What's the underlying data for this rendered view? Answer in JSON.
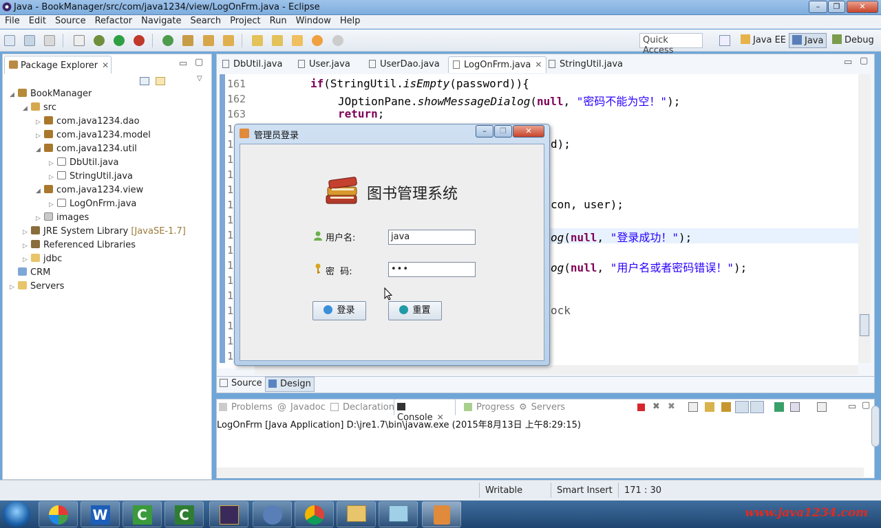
{
  "window": {
    "title": "Java - BookManager/src/com/java1234/view/LogOnFrm.java - Eclipse"
  },
  "menu": [
    "File",
    "Edit",
    "Source",
    "Refactor",
    "Navigate",
    "Search",
    "Project",
    "Run",
    "Window",
    "Help"
  ],
  "toolbar": {
    "quick_access": "Quick Access",
    "perspectives": [
      "Java EE",
      "Java",
      "Debug"
    ]
  },
  "package_explorer": {
    "title": "Package Explorer",
    "items": [
      "BookManager",
      "src",
      "com.java1234.dao",
      "com.java1234.model",
      "com.java1234.util",
      "DbUtil.java",
      "StringUtil.java",
      "com.java1234.view",
      "LogOnFrm.java",
      "images",
      "JRE System Library",
      "[JavaSE-1.7]",
      "Referenced Libraries",
      "jdbc",
      "CRM",
      "Servers"
    ]
  },
  "editor": {
    "tabs": [
      "DbUtil.java",
      "User.java",
      "UserDao.java",
      "LogOnFrm.java",
      "StringUtil.java"
    ],
    "active_tab": "LogOnFrm.java",
    "line_numbers": [
      "161",
      "162",
      "163",
      "1",
      "1",
      "1",
      "1",
      "1",
      "1",
      "1",
      "1",
      "1",
      "1",
      "1",
      "1",
      "1",
      "1",
      "1",
      "1"
    ],
    "code": {
      "l161_kw": "if",
      "l161_a": "(StringUtil.",
      "l161_it": "isEmpty",
      "l161_b": "(password)){",
      "l162_a": "JOptionPane.",
      "l162_it": "showMessageDialog",
      "l162_b": "(",
      "l162_null": "null",
      "l162_c": ", ",
      "l162_str": "\"密码不能为空！\"",
      "l162_d": ");",
      "l163_kw": "return",
      "l163_a": ";",
      "r1": "d);",
      "r2": "con, user);",
      "r3_it": "og",
      "r3_a": "(",
      "r3_null": "null",
      "r3_b": ", ",
      "r3_str": "\"登录成功！\"",
      "r3_c": ");",
      "r4_it": "og",
      "r4_a": "(",
      "r4_null": "null",
      "r4_b": ", ",
      "r4_str": "\"用户名或者密码错误！\"",
      "r4_c": ");",
      "r5": "ock"
    },
    "bottom_tabs": [
      "Source",
      "Design"
    ]
  },
  "dialog": {
    "title": "管理员登录",
    "heading": "图书管理系统",
    "username_label": "用户名:",
    "username_value": "java",
    "password_label": "密  码:",
    "password_value": "•••",
    "login_button": "登录",
    "reset_button": "重置"
  },
  "console": {
    "tabs": [
      "Problems",
      "Javadoc",
      "Declaration",
      "Console",
      "Progress",
      "Servers"
    ],
    "active_tab": "Console",
    "launch_text": "LogOnFrm [Java Application] D:\\jre1.7\\bin\\javaw.exe (2015年8月13日 上午8:29:15)"
  },
  "status": {
    "writable": "Writable",
    "insert_mode": "Smart Insert",
    "position": "171 : 30"
  },
  "watermark": "www.java1234.com"
}
